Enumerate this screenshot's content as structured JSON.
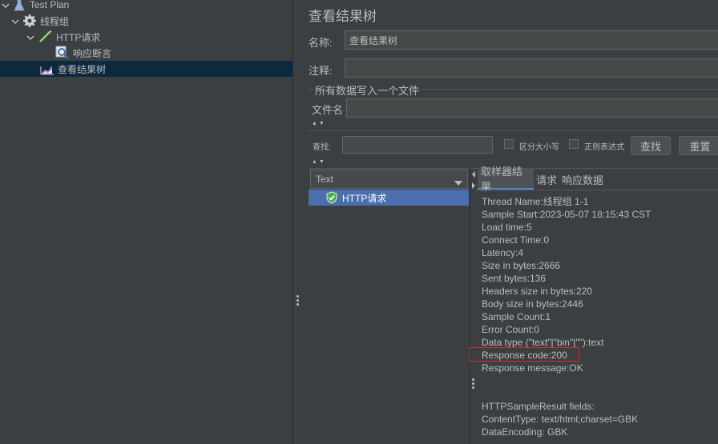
{
  "tree": {
    "items": [
      {
        "label": "Test Plan"
      },
      {
        "label": "线程组"
      },
      {
        "label": "HTTP请求"
      },
      {
        "label": "响应断言"
      },
      {
        "label": "查看结果树"
      }
    ]
  },
  "panel": {
    "title": "查看结果树",
    "name_label": "名称:",
    "name_value": "查看结果树",
    "comment_label": "注释:",
    "comment_value": "",
    "file_group_title": "所有数据写入一个文件",
    "filename_label": "文件名",
    "filename_value": ""
  },
  "search": {
    "label": "查找:",
    "value": "",
    "case_sensitive_label": "区分大小写",
    "regex_label": "正则表达式",
    "find_button": "查找",
    "reset_button": "重置"
  },
  "renderer": {
    "selected": "Text"
  },
  "results": {
    "items": [
      {
        "label": "HTTP请求",
        "status": "success"
      }
    ]
  },
  "tabs": [
    {
      "label": "取样器结果"
    },
    {
      "label": "请求"
    },
    {
      "label": "响应数据"
    }
  ],
  "details": {
    "lines": [
      "Thread Name:线程组 1-1",
      "Sample Start:2023-05-07 18:15:43 CST",
      "Load time:5",
      "Connect Time:0",
      "Latency:4",
      "Size in bytes:2666",
      "Sent bytes:136",
      "Headers size in bytes:220",
      "Body size in bytes:2446",
      "Sample Count:1",
      "Error Count:0",
      "Data type (\"text\"|\"bin\"|\"\"):text",
      "Response code:200",
      "Response message:OK",
      "",
      "",
      "HTTPSampleResult fields:",
      "ContentType: text/html;charset=GBK",
      "DataEncoding: GBK"
    ]
  },
  "colors": {
    "background": "#3c3f41",
    "selection": "#0d293e",
    "list_selection": "#4b6eaf",
    "highlight_box": "#e3262a",
    "tab_accent": "#4a88c7"
  }
}
